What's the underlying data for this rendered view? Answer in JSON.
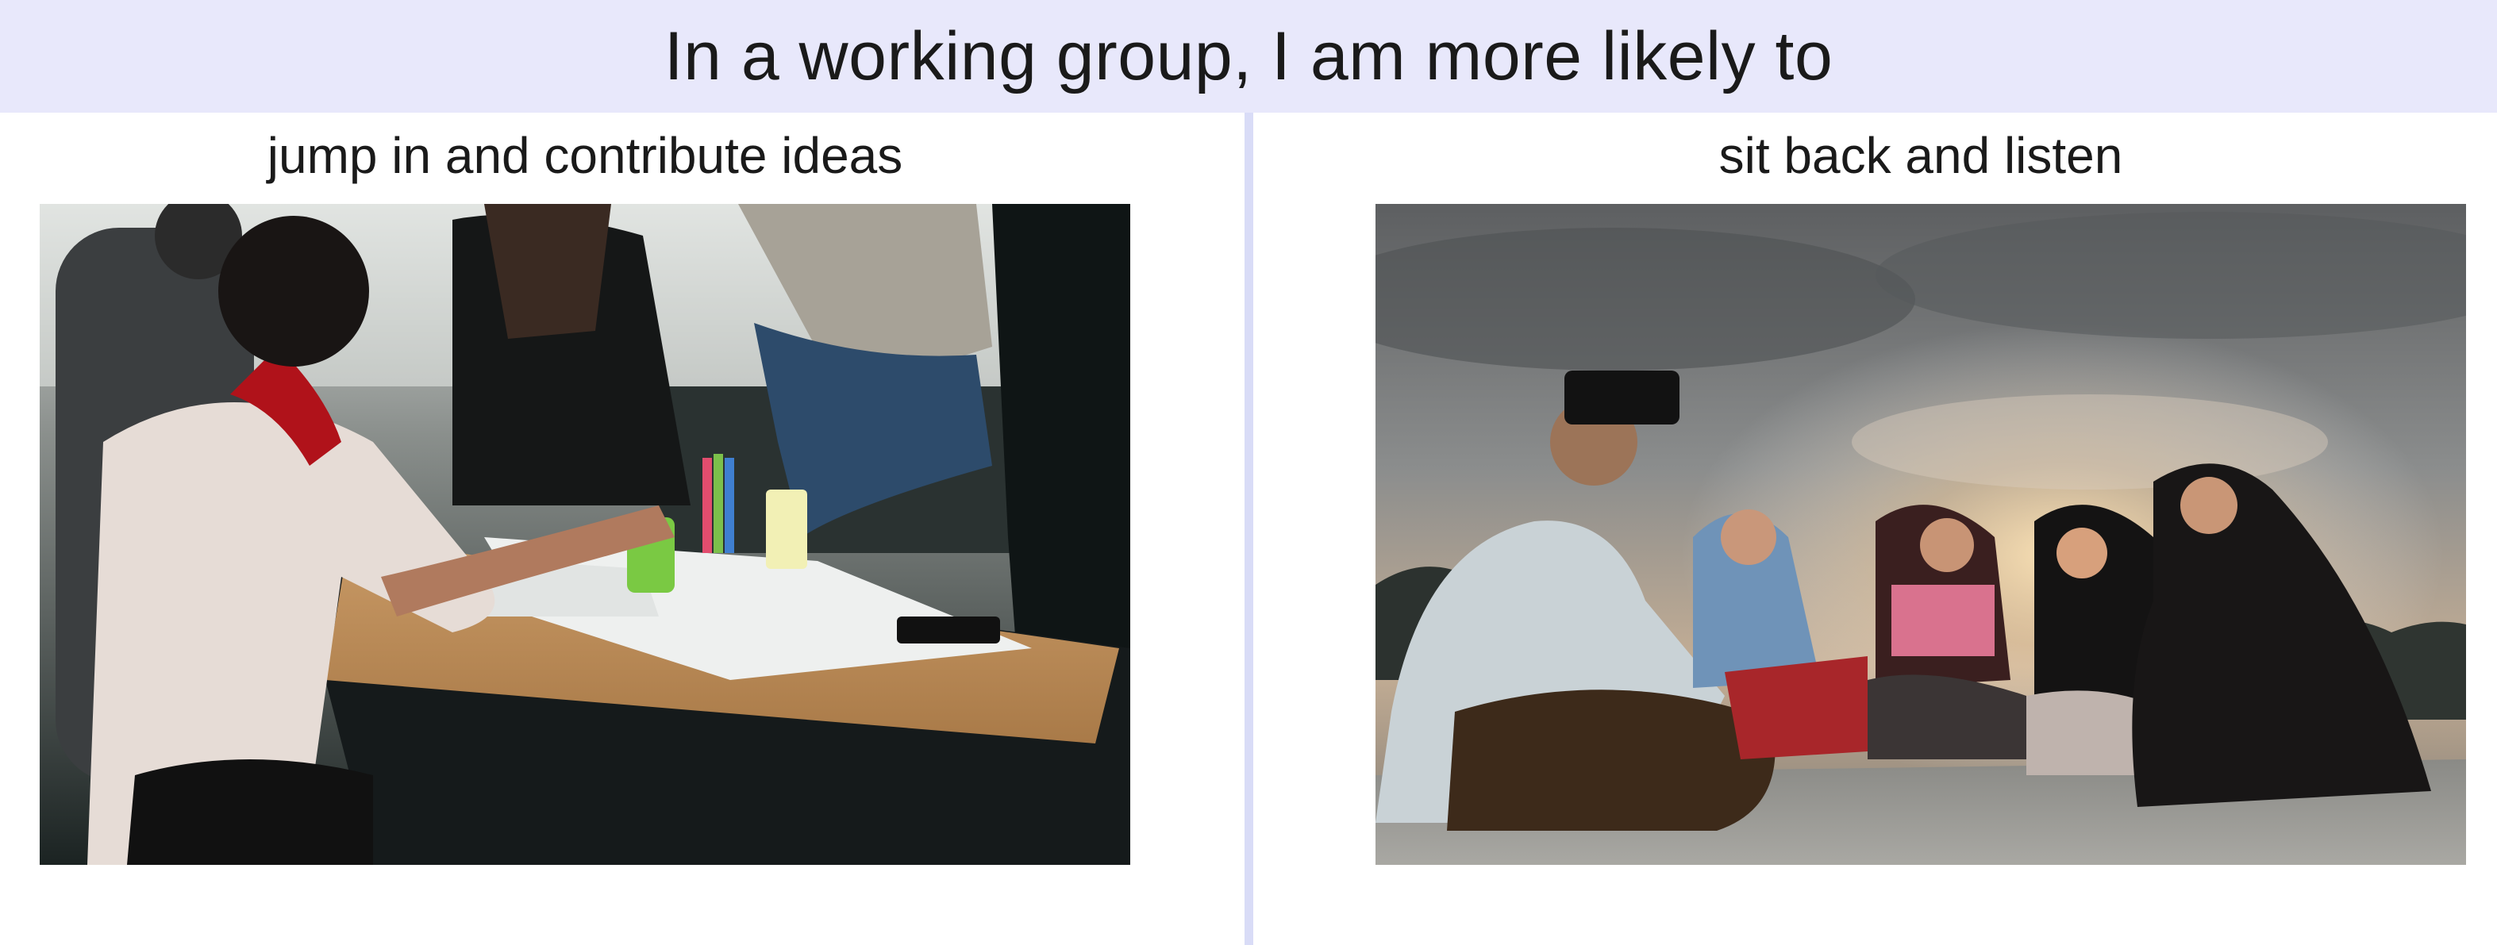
{
  "slide": {
    "title": "In a working group, I am more likely to"
  },
  "options": [
    {
      "label": "jump in and contribute ideas",
      "image_icon": "group-collaboration-photo"
    },
    {
      "label": "sit back and listen",
      "image_icon": "group-listening-photo"
    }
  ],
  "colors": {
    "header_background": "#e8e8fb",
    "divider": "#d9dcf7",
    "text": "#1a1a1a"
  }
}
